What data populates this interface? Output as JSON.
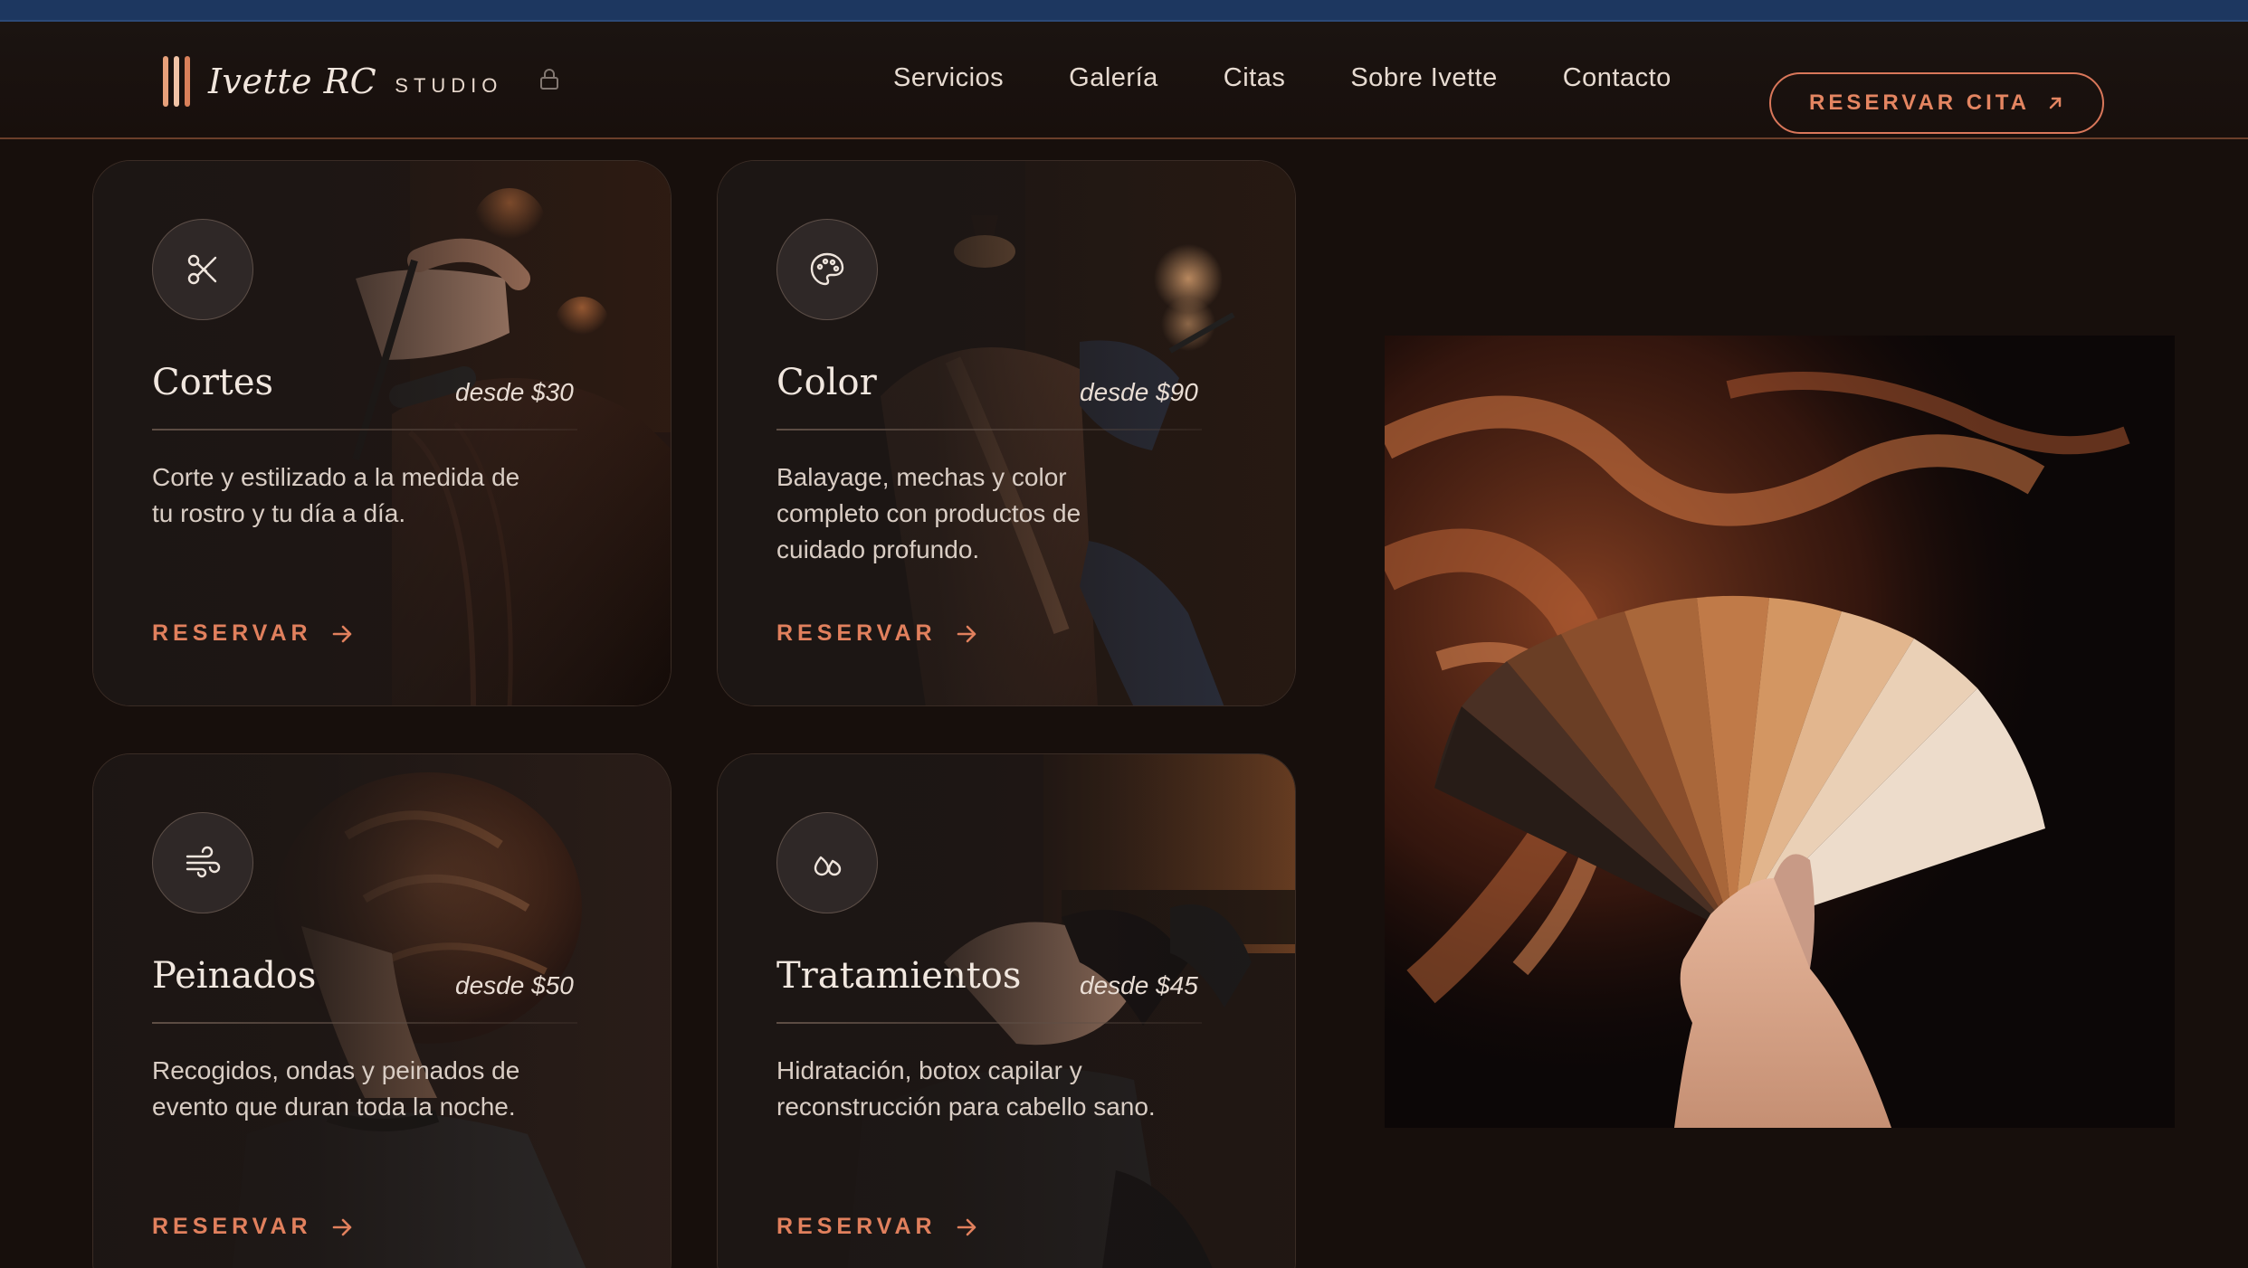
{
  "brand": {
    "name": "Ivette RC",
    "sub": "STUDIO",
    "accent": "#e1805d",
    "bg": "#170f0c"
  },
  "nav": {
    "items": [
      "Servicios",
      "Galería",
      "Citas",
      "Sobre Ivette",
      "Contacto"
    ],
    "cta_label": "RESERVAR CITA"
  },
  "services": [
    {
      "icon": "scissors-icon",
      "title": "Cortes",
      "price": "desde $30",
      "desc_lines": [
        "Corte y estilizado a la medida de",
        "tu rostro y tu día a día."
      ],
      "link": "RESERVAR"
    },
    {
      "icon": "palette-icon",
      "title": "Color",
      "price": "desde $90",
      "desc_lines": [
        "Balayage, mechas y color",
        "completo con productos de",
        "cuidado profundo."
      ],
      "link": "RESERVAR"
    },
    {
      "icon": "wind-icon",
      "title": "Peinados",
      "price": "desde $50",
      "desc_lines": [
        "Recogidos, ondas y peinados de",
        "evento que duran toda la noche."
      ],
      "link": "RESERVAR"
    },
    {
      "icon": "droplets-icon",
      "title": "Tratamientos",
      "price": "desde $45",
      "desc_lines": [
        "Hidratación, botox capilar y",
        "reconstrucción para cabello sano."
      ],
      "link": "RESERVAR"
    }
  ]
}
